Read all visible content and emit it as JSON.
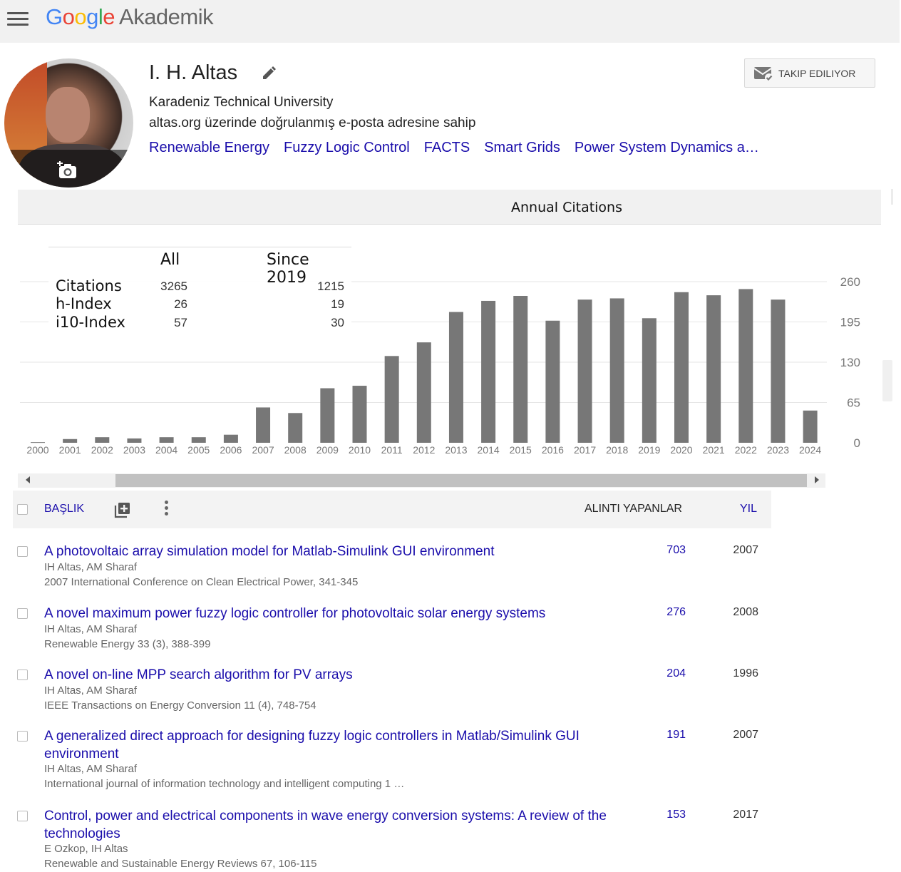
{
  "header": {
    "logo": {
      "g1": "G",
      "g2": "o",
      "g3": "o",
      "g4": "g",
      "g5": "l",
      "g6": "e",
      "suffix": "Akademik"
    },
    "menu_icon": "hamburger-menu-icon"
  },
  "profile": {
    "name": "I. H. Altas",
    "affiliation": "Karadeniz Technical University",
    "email_note": "altas.org üzerinde doğrulanmış e-posta adresine sahip",
    "interests": [
      "Renewable Energy",
      "Fuzzy Logic Control",
      "FACTS",
      "Smart Grids",
      "Power System Dynamics a…"
    ],
    "follow_label": "TAKIP EDILIYOR"
  },
  "stats": {
    "col_all": "All",
    "col_since": "Since 2019",
    "rows": [
      {
        "label": "Citations",
        "all": "3265",
        "since": "1215"
      },
      {
        "label": "h-Index",
        "all": "26",
        "since": "19"
      },
      {
        "label": "i10-Index",
        "all": "57",
        "since": "30"
      }
    ]
  },
  "chart_data": {
    "type": "bar",
    "title": "Annual Citations",
    "categories": [
      "2000",
      "2001",
      "2002",
      "2003",
      "2004",
      "2005",
      "2006",
      "2007",
      "2008",
      "2009",
      "2010",
      "2011",
      "2012",
      "2013",
      "2014",
      "2015",
      "2016",
      "2017",
      "2018",
      "2019",
      "2020",
      "2021",
      "2022",
      "2023",
      "2024"
    ],
    "values": [
      1,
      6,
      9,
      7,
      9,
      9,
      13,
      57,
      48,
      88,
      92,
      140,
      162,
      211,
      229,
      237,
      197,
      231,
      233,
      201,
      243,
      238,
      248,
      231,
      52
    ],
    "yticks": [
      0,
      65,
      130,
      195,
      260
    ],
    "ylim": [
      0,
      260
    ],
    "bar_color": "#777777",
    "ylabel_position": "right"
  },
  "table": {
    "header": {
      "title": "BAŞLIK",
      "cited_by": "ALINTI YAPANLAR",
      "year": "YIL"
    },
    "rows": [
      {
        "title": "A photovoltaic array simulation model for Matlab-Simulink GUI environment",
        "authors": "IH Altas, AM Sharaf",
        "venue": "2007 International Conference on Clean Electrical Power, 341-345",
        "cites": "703",
        "year": "2007"
      },
      {
        "title": "A novel maximum power fuzzy logic controller for photovoltaic solar energy systems",
        "authors": "IH Altas, AM Sharaf",
        "venue": "Renewable Energy 33 (3), 388-399",
        "cites": "276",
        "year": "2008"
      },
      {
        "title": "A novel on-line MPP search algorithm for PV arrays",
        "authors": "IH Altas, AM Sharaf",
        "venue": "IEEE Transactions on Energy Conversion 11 (4), 748-754",
        "cites": "204",
        "year": "1996"
      },
      {
        "title": "A generalized direct approach for designing fuzzy logic controllers in Matlab/Simulink GUI environment",
        "authors": "IH Altas, AM Sharaf",
        "venue": "International journal of information technology and intelligent computing 1 …",
        "cites": "191",
        "year": "2007"
      },
      {
        "title": "Control, power and electrical components in wave energy conversion systems: A review of the technologies",
        "authors": "E Ozkop, IH Altas",
        "venue": "Renewable and Sustainable Energy Reviews 67, 106-115",
        "cites": "153",
        "year": "2017"
      }
    ]
  }
}
